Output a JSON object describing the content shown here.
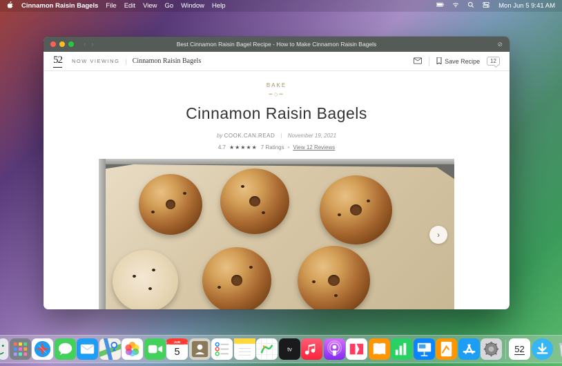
{
  "menubar": {
    "app": "Cinnamon Raisin Bagels",
    "items": [
      "File",
      "Edit",
      "View",
      "Go",
      "Window",
      "Help"
    ],
    "clock": "Mon Jun 5 9:41 AM"
  },
  "window": {
    "title": "Best Cinnamon Raisin Bagel Recipe - How to Make Cinnamon Raisin Bagels"
  },
  "site_header": {
    "logo": "52",
    "now_viewing": "NOW VIEWING",
    "breadcrumb": "Cinnamon Raisin Bagels",
    "save_label": "Save Recipe",
    "comment_count": "12"
  },
  "article": {
    "category": "BAKE",
    "title": "Cinnamon Raisin Bagels",
    "byline_prefix": "by",
    "author": "COOK.CAN.READ",
    "date": "November 19, 2021",
    "rating_value": "4.7",
    "stars": "★★★★★",
    "ratings_text": "7 Ratings",
    "reviews_link": "View 12 Reviews"
  },
  "dock": {
    "apps": [
      "Finder",
      "Launchpad",
      "Safari",
      "Messages",
      "Mail",
      "Maps",
      "Photos",
      "FaceTime",
      "Calendar",
      "Contacts",
      "Reminders",
      "Notes",
      "Freeform",
      "TV",
      "Music",
      "Podcasts",
      "News",
      "Books",
      "Numbers",
      "Keynote",
      "Pages",
      "App Store",
      "System Settings"
    ],
    "recents": [
      "Food52",
      "Downloads",
      "Trash"
    ],
    "calendar_day": "5",
    "calendar_month": "JUN",
    "recent_label": "52"
  }
}
